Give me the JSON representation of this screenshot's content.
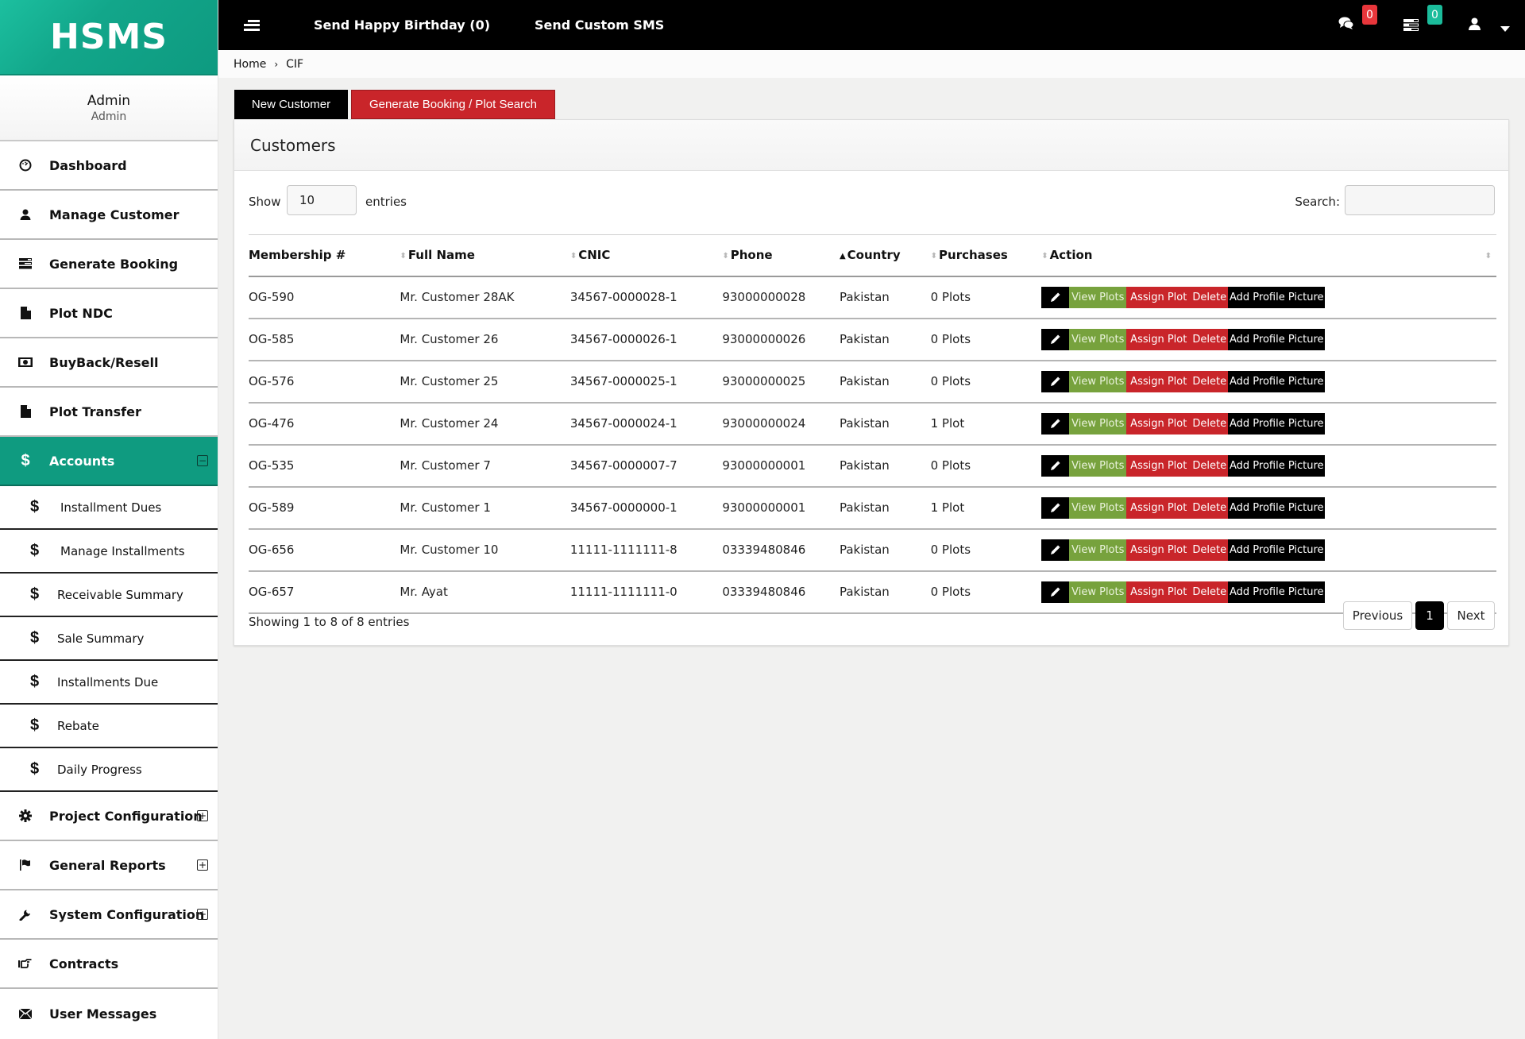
{
  "app": {
    "logo": "HSMS"
  },
  "profile": {
    "name": "Admin",
    "role": "Admin"
  },
  "sidebar": {
    "items": [
      {
        "label": "Dashboard",
        "icon": "dashboard-icon"
      },
      {
        "label": "Manage Customer",
        "icon": "user-icon"
      },
      {
        "label": "Generate Booking",
        "icon": "tasks-icon"
      },
      {
        "label": "Plot NDC",
        "icon": "file-icon"
      },
      {
        "label": "BuyBack/Resell",
        "icon": "money-icon"
      },
      {
        "label": "Plot Transfer",
        "icon": "file-icon"
      },
      {
        "label": "Accounts",
        "icon": "dollar-icon",
        "active": true,
        "toggle": "−"
      }
    ],
    "accounts_sub": [
      {
        "label": "Installment Dues"
      },
      {
        "label": "Manage Installments"
      },
      {
        "label": "Receivable Summary"
      },
      {
        "label": "Sale Summary"
      },
      {
        "label": "Installments Due"
      },
      {
        "label": "Rebate"
      },
      {
        "label": "Daily Progress"
      }
    ],
    "items_after": [
      {
        "label": "Project Configuration",
        "icon": "gear-icon",
        "toggle": "+"
      },
      {
        "label": "General Reports",
        "icon": "flag-icon",
        "toggle": "+"
      },
      {
        "label": "System Configuration",
        "icon": "wrench-icon",
        "toggle": "+"
      },
      {
        "label": "Contracts",
        "icon": "hand-pointer-icon"
      },
      {
        "label": "User Messages",
        "icon": "envelope-icon"
      }
    ],
    "sub_icon": "$"
  },
  "topbar": {
    "links": [
      "Send Happy Birthday (0)",
      "Send Custom SMS"
    ],
    "messages_badge": "0",
    "tasks_badge": "0",
    "colors": {
      "badge_red": "#e8363b",
      "badge_teal": "#1bbc9b"
    }
  },
  "breadcrumb": {
    "home": "Home",
    "sep": "›",
    "current": "CIF"
  },
  "actions": {
    "new_customer": "New Customer",
    "generate_booking": "Generate Booking / Plot Search"
  },
  "panel": {
    "title": "Customers",
    "show_label": "Show",
    "page_length": "10",
    "entries_label": "entries",
    "search_label": "Search:",
    "search_value": ""
  },
  "table": {
    "columns": [
      "Membership #",
      "Full Name",
      "CNIC",
      "Phone",
      "Country",
      "Purchases",
      "Action",
      ""
    ],
    "sorted_column": "Country",
    "action_buttons": {
      "edit": "✎",
      "view": "View Plots",
      "assign": "Assign Plot",
      "delete": "Delete",
      "profile": "Add Profile Picture"
    },
    "rows": [
      {
        "membership": "OG-590",
        "name": "Mr. Customer 28AK",
        "cnic": "34567-0000028-1",
        "phone": "93000000028",
        "country": "Pakistan",
        "purchases": "0 Plots"
      },
      {
        "membership": "OG-585",
        "name": "Mr. Customer 26",
        "cnic": "34567-0000026-1",
        "phone": "93000000026",
        "country": "Pakistan",
        "purchases": "0 Plots"
      },
      {
        "membership": "OG-576",
        "name": "Mr. Customer 25",
        "cnic": "34567-0000025-1",
        "phone": "93000000025",
        "country": "Pakistan",
        "purchases": "0 Plots"
      },
      {
        "membership": "OG-476",
        "name": "Mr. Customer 24",
        "cnic": "34567-0000024-1",
        "phone": "93000000024",
        "country": "Pakistan",
        "purchases": "1 Plot"
      },
      {
        "membership": "OG-535",
        "name": "Mr. Customer 7",
        "cnic": "34567-0000007-7",
        "phone": "93000000001",
        "country": "Pakistan",
        "purchases": "0 Plots"
      },
      {
        "membership": "OG-589",
        "name": "Mr. Customer 1",
        "cnic": "34567-0000000-1",
        "phone": "93000000001",
        "country": "Pakistan",
        "purchases": "1 Plot"
      },
      {
        "membership": "OG-656",
        "name": "Mr. Customer 10",
        "cnic": "11111-1111111-8",
        "phone": "03339480846",
        "country": "Pakistan",
        "purchases": "0 Plots"
      },
      {
        "membership": "OG-657",
        "name": "Mr. Ayat",
        "cnic": "11111-1111111-0",
        "phone": "03339480846",
        "country": "Pakistan",
        "purchases": "0 Plots"
      }
    ]
  },
  "footer": {
    "info": "Showing 1 to 8 of 8 entries",
    "prev": "Previous",
    "current_page": "1",
    "next": "Next"
  }
}
